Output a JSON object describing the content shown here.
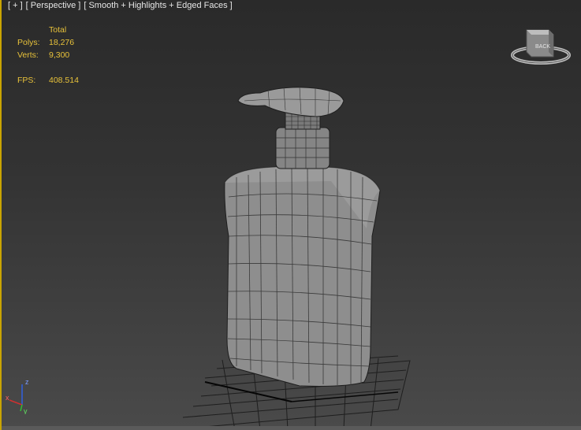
{
  "viewport": {
    "labels": [
      "[ + ]",
      "[ Perspective ]",
      "[ Smooth + Highlights + Edged Faces ]"
    ]
  },
  "stats": {
    "header": "Total",
    "polys_label": "Polys:",
    "polys_value": "18,276",
    "verts_label": "Verts:",
    "verts_value": "9,300",
    "fps_label": "FPS:",
    "fps_value": "408.514"
  },
  "viewcube": {
    "face_label": "BACK"
  },
  "axes": {
    "x": "x",
    "y": "y",
    "z": "z"
  },
  "colors": {
    "stats_text": "#e8c23a",
    "active_border": "#c9a400",
    "axis_x": "#d03030",
    "axis_y": "#30c030",
    "axis_z": "#3060e0"
  }
}
